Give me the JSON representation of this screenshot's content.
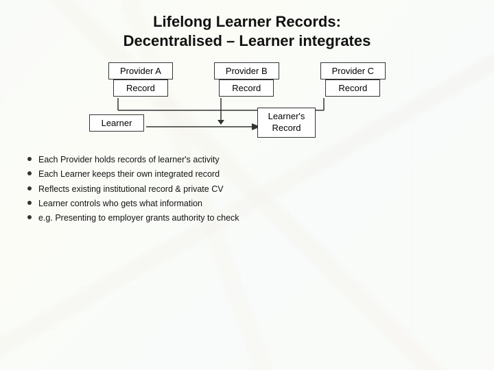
{
  "title": {
    "line1": "Lifelong Learner Records:",
    "line2": "Decentralised – Learner integrates"
  },
  "providers": [
    {
      "label": "Provider A"
    },
    {
      "label": "Provider B"
    },
    {
      "label": "Provider C"
    }
  ],
  "records": [
    {
      "label": "Record"
    },
    {
      "label": "Record"
    },
    {
      "label": "Record"
    }
  ],
  "learner_box": {
    "label": "Learner"
  },
  "learners_record_box": {
    "line1": "Learner's",
    "line2": "Record"
  },
  "bullets": [
    {
      "text": "Each Provider holds records of learner's activity"
    },
    {
      "text": "Each Learner keeps their own integrated record"
    },
    {
      "text": "Reflects existing institutional record & private CV"
    },
    {
      "text": "Learner controls who gets what information"
    },
    {
      "text": "e.g. Presenting to employer grants authority to check"
    }
  ]
}
